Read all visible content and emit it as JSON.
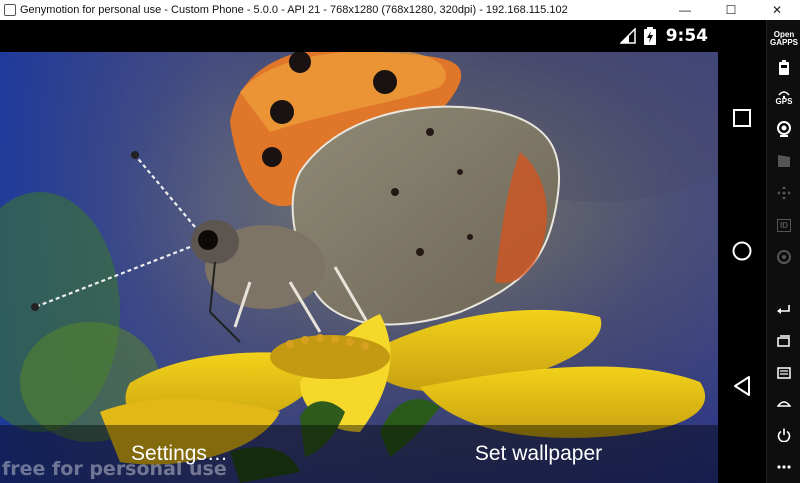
{
  "window": {
    "title": "Genymotion for personal use - Custom Phone - 5.0.0 - API 21 - 768x1280 (768x1280, 320dpi) - 192.168.115.102",
    "minimize": "—",
    "maximize": "☐",
    "close": "✕"
  },
  "statusbar": {
    "time": "9:54"
  },
  "wallpaper": {
    "settings_label": "Settings…",
    "set_wallpaper_label": "Set wallpaper"
  },
  "watermark": "free for personal use",
  "toolbar": {
    "opengapps_line1": "Open",
    "opengapps_line2": "GAPPS",
    "gps_label": "GPS",
    "id_label": "ID"
  }
}
